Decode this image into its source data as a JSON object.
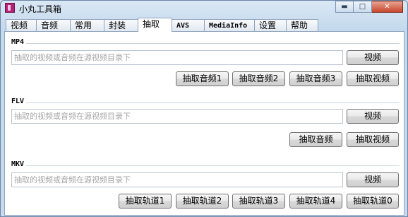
{
  "window": {
    "title": "小丸工具箱"
  },
  "tabs": [
    {
      "label": "视频"
    },
    {
      "label": "音频"
    },
    {
      "label": "常用"
    },
    {
      "label": "封装"
    },
    {
      "label": "抽取"
    },
    {
      "label": "AVS"
    },
    {
      "label": "MediaInfo"
    },
    {
      "label": "设置"
    },
    {
      "label": "帮助"
    }
  ],
  "active_tab": "抽取",
  "sections": {
    "mp4": {
      "label": "MP4",
      "input_placeholder": "抽取的视频或音频在源视频目录下",
      "browse_label": "视频",
      "buttons": [
        "抽取音频1",
        "抽取音频2",
        "抽取音频3",
        "抽取视频"
      ]
    },
    "flv": {
      "label": "FLV",
      "input_placeholder": "抽取的视频或音频在源视频目录下",
      "browse_label": "视频",
      "buttons": [
        "抽取音频",
        "抽取视频"
      ]
    },
    "mkv": {
      "label": "MKV",
      "input_placeholder": "抽取的视频或音频在源视频目录下",
      "browse_label": "视频",
      "buttons": [
        "抽取轨道1",
        "抽取轨道2",
        "抽取轨道3",
        "抽取轨道4",
        "抽取轨道0"
      ]
    }
  },
  "colors": {
    "app_icon": "#b2227a",
    "close_button": "#c9462c",
    "window_frame": "#c8dbee"
  },
  "icons": {
    "app": "app-icon",
    "minimize": "minimize-icon",
    "maximize": "maximize-icon",
    "close": "close-icon"
  }
}
